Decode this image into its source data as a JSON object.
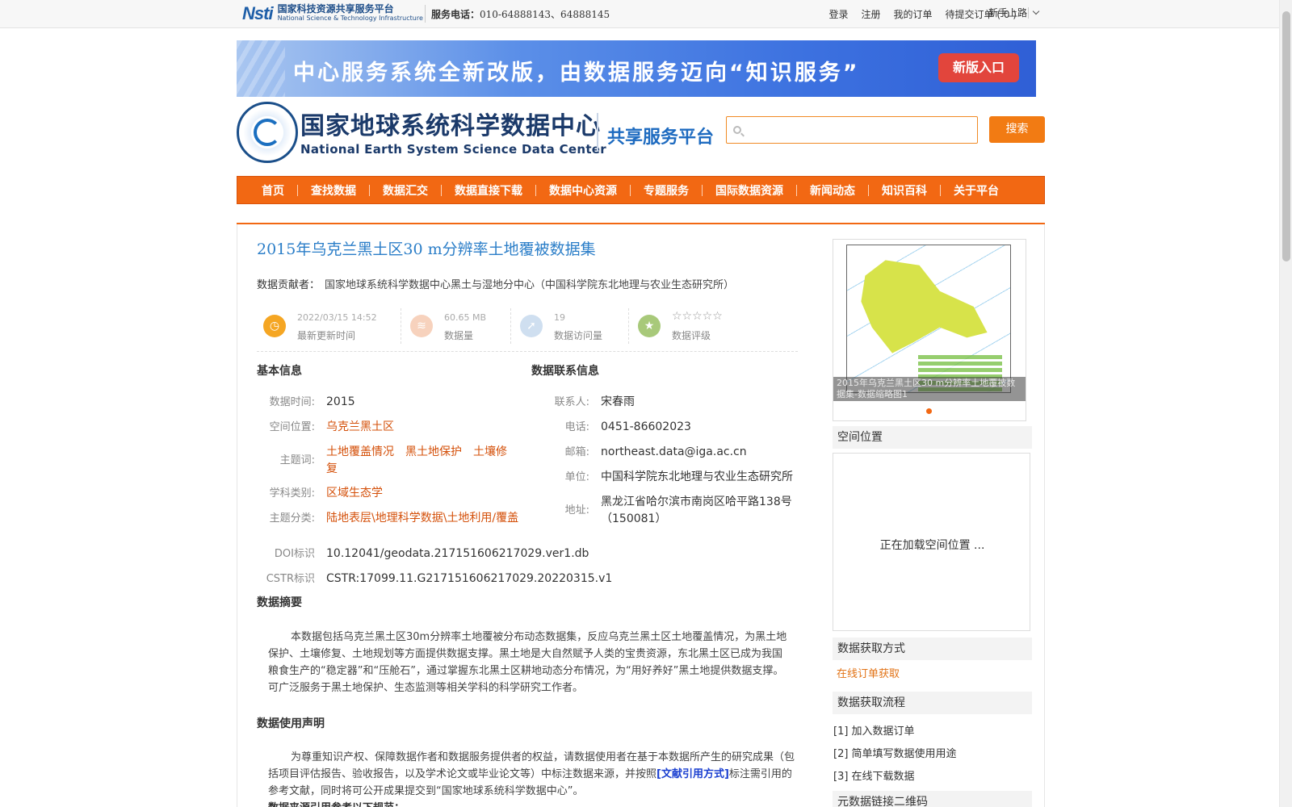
{
  "topbar": {
    "logo_mark": "Nsti",
    "logo_cn": "国家科技资源共享服务平台",
    "logo_en": "National Science & Technology Infrastructure",
    "phone_label": "服务电话：",
    "phone_value": "010-64888143、64888145",
    "links": [
      "登录",
      "注册",
      "我的订单",
      "待提交订单 ( 0 )"
    ],
    "newbie": "新手上路"
  },
  "banner": {
    "text": "中心服务系统全新改版，由数据服务迈向“知识服务”",
    "button": "新版入口"
  },
  "header": {
    "title_cn": "国家地球系统科学数据中心",
    "title_en": "National Earth System Science Data Center",
    "platform": "共享服务平台",
    "search_placeholder": "",
    "search_button": "搜索"
  },
  "nav": [
    "首页",
    "查找数据",
    "数据汇交",
    "数据直接下载",
    "数据中心资源",
    "专题服务",
    "国际数据资源",
    "新闻动态",
    "知识百科",
    "关于平台"
  ],
  "dataset": {
    "title": "2015年乌克兰黑土区30 m分辨率土地覆被数据集",
    "contributor_label": "数据贡献者：",
    "contributor": "国家地球系统科学数据中心黑土与湿地分中心（中国科学院东北地理与农业生态研究所）",
    "stats": {
      "updated_value": "2022/03/15 14:52",
      "updated_label": "最新更新时间",
      "size_value": "60.65 MB",
      "size_label": "数据量",
      "visits_value": "19",
      "visits_label": "数据访问量",
      "rating_stars": "☆☆☆☆☆",
      "rating_label": "数据评级"
    },
    "basic_head": "基本信息",
    "contact_head": "数据联系信息",
    "basic": {
      "time_k": "数据时间:",
      "time_v": "2015",
      "space_k": "空间位置:",
      "space_v": "乌克兰黑土区",
      "keywords_k": "主题词:",
      "keywords_v1": "土地覆盖情况　黑土地保护　土壤修",
      "keywords_v2": "复",
      "subject_k": "学科类别:",
      "subject_v": "区域生态学",
      "category_k": "主题分类:",
      "category_v": "陆地表层\\地理科学数据\\土地利用/覆盖",
      "doi_k": "DOI标识",
      "doi_v": "10.12041/geodata.217151606217029.ver1.db",
      "cstr_k": "CSTR标识",
      "cstr_v": "CSTR:17099.11.G217151606217029.20220315.v1"
    },
    "contact": {
      "person_k": "联系人:",
      "person_v": "宋春雨",
      "phone_k": "电话:",
      "phone_v": "0451-86602023",
      "email_k": "邮箱:",
      "email_v": "northeast.data@iga.ac.cn",
      "unit_k": "单位:",
      "unit_v": "中国科学院东北地理与农业生态研究所",
      "addr_k": "地址:",
      "addr_v1": "黑龙江省哈尔滨市南岗区哈平路138号",
      "addr_v2": "（150081）"
    },
    "abstract_head": "数据摘要",
    "abstract": "本数据包括乌克兰黑土区30m分辨率土地覆被分布动态数据集，反应乌克兰黑土区土地覆盖情况，为黑土地保护、土壤修复、土地规划等方面提供数据支撑。黑土地是大自然赋予人类的宝贵资源，东北黑土区已成为我国粮食生产的“稳定器”和“压舱石”，通过掌握东北黑土区耕地动态分布情况，为“用好养好”黑土地提供数据支撑。可广泛服务于黑土地保护、生态监测等相关学科的科学研究工作者。",
    "usage_head": "数据使用声明",
    "usage_pre": "为尊重知识产权、保障数据作者和数据服务提供者的权益，请数据使用者在基于本数据所产生的研究成果（包括项目评估报告、验收报告，以及学术论文或毕业论文等）中标注数据来源，并按照",
    "usage_ref": "[文献引用方式]",
    "usage_post": "标注需引用的参考文献，同时将可公开成果提交到“国家地球系统科学数据中心”。",
    "usage_tail": "数据来源引用参考以下规范："
  },
  "side": {
    "thumb_caption": "2015年乌克兰黑土区30 m分辨率土地覆被数据集-数据缩略图1",
    "spatial_head": "空间位置",
    "spatial_loading": "正在加载空间位置 ...",
    "access_head": "数据获取方式",
    "access_link": "在线订单获取",
    "flow_head": "数据获取流程",
    "steps": [
      "[1] 加入数据订单",
      "[2] 简单填写数据使用用途",
      "[3] 在线下载数据"
    ],
    "qr_head": "元数据链接二维码"
  },
  "colors": {
    "nav_bg": "#f26813",
    "link_orange": "#d4500a",
    "title_blue": "#2b7ec8",
    "button_orange": "#f27b13"
  }
}
